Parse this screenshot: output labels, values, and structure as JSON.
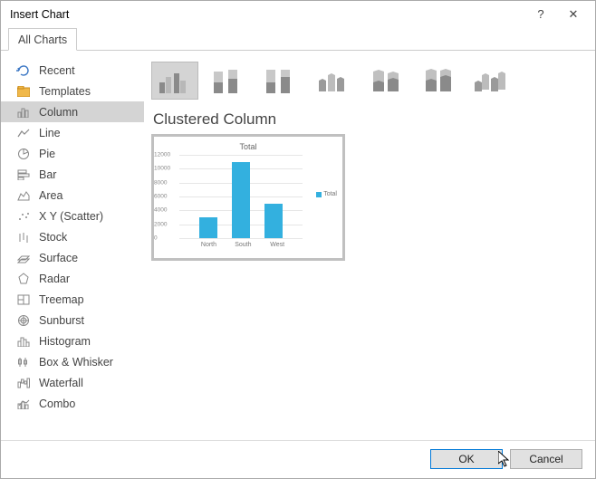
{
  "dialog": {
    "title": "Insert Chart"
  },
  "tabs": {
    "active": "All Charts"
  },
  "sidebar": {
    "items": [
      {
        "label": "Recent",
        "icon": "recent-icon"
      },
      {
        "label": "Templates",
        "icon": "templates-icon"
      },
      {
        "label": "Column",
        "icon": "column-icon",
        "selected": true
      },
      {
        "label": "Line",
        "icon": "line-icon"
      },
      {
        "label": "Pie",
        "icon": "pie-icon"
      },
      {
        "label": "Bar",
        "icon": "bar-icon"
      },
      {
        "label": "Area",
        "icon": "area-icon"
      },
      {
        "label": "X Y (Scatter)",
        "icon": "scatter-icon"
      },
      {
        "label": "Stock",
        "icon": "stock-icon"
      },
      {
        "label": "Surface",
        "icon": "surface-icon"
      },
      {
        "label": "Radar",
        "icon": "radar-icon"
      },
      {
        "label": "Treemap",
        "icon": "treemap-icon"
      },
      {
        "label": "Sunburst",
        "icon": "sunburst-icon"
      },
      {
        "label": "Histogram",
        "icon": "histogram-icon"
      },
      {
        "label": "Box & Whisker",
        "icon": "boxwhisker-icon"
      },
      {
        "label": "Waterfall",
        "icon": "waterfall-icon"
      },
      {
        "label": "Combo",
        "icon": "combo-icon"
      }
    ]
  },
  "subtypes": [
    {
      "name": "clustered-column",
      "selected": true
    },
    {
      "name": "stacked-column"
    },
    {
      "name": "100-stacked-column"
    },
    {
      "name": "3d-clustered-column"
    },
    {
      "name": "3d-stacked-column"
    },
    {
      "name": "3d-100-stacked-column"
    },
    {
      "name": "3d-column"
    }
  ],
  "preview": {
    "heading": "Clustered Column",
    "chart_title": "Total"
  },
  "footer": {
    "ok": "OK",
    "cancel": "Cancel"
  },
  "chart_data": {
    "type": "bar",
    "categories": [
      "North",
      "South",
      "West"
    ],
    "series": [
      {
        "name": "Total",
        "values": [
          3000,
          11000,
          5000
        ]
      }
    ],
    "title": "Total",
    "xlabel": "",
    "ylabel": "",
    "ylim": [
      0,
      12000
    ],
    "yticks": [
      0,
      2000,
      4000,
      6000,
      8000,
      10000,
      12000
    ],
    "legend": {
      "position": "right",
      "entries": [
        "Total"
      ]
    },
    "colors": {
      "series_0": "#33b0df"
    }
  }
}
